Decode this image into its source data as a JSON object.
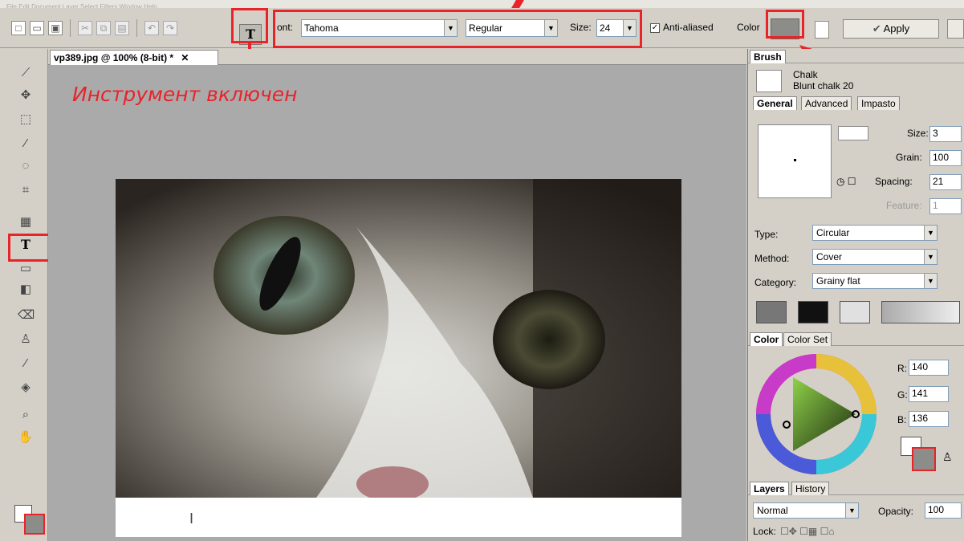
{
  "toolbar": {
    "font_label": "ont:",
    "font_value": "Tahoma",
    "style_value": "Regular",
    "size_label": "Size:",
    "size_value": "24",
    "antialias_label": "Anti-aliased",
    "color_label": "Color",
    "apply_label": "Apply",
    "text_tool_icon": "T"
  },
  "document": {
    "tab_title": "vp389.jpg @ 100% (8-bit) *",
    "close_glyph": "✕"
  },
  "annotation": {
    "text": "Инструмент включен",
    "color": "#e8232a"
  },
  "brush_panel": {
    "tab": "Brush",
    "brush_name": "Chalk",
    "brush_variant": "Blunt chalk 20",
    "tabs": [
      "General",
      "Advanced",
      "Impasto"
    ],
    "size_label": "Size:",
    "size_value": "3",
    "grain_label": "Grain:",
    "grain_value": "100",
    "spacing_label": "Spacing:",
    "spacing_value": "21",
    "feature_label": "Feature:",
    "feature_value": "1",
    "type_label": "Type:",
    "type_value": "Circular",
    "method_label": "Method:",
    "method_value": "Cover",
    "category_label": "Category:",
    "category_value": "Grainy flat"
  },
  "color_panel": {
    "tabs": [
      "Color",
      "Color Set"
    ],
    "r_label": "R:",
    "r_value": "140",
    "g_label": "G:",
    "g_value": "141",
    "b_label": "B:",
    "b_value": "136",
    "current_color": "#8c8d88"
  },
  "layers_panel": {
    "tabs": [
      "Layers",
      "History"
    ],
    "blend_value": "Normal",
    "opacity_label": "Opacity:",
    "opacity_value": "100",
    "lock_label": "Lock:"
  }
}
